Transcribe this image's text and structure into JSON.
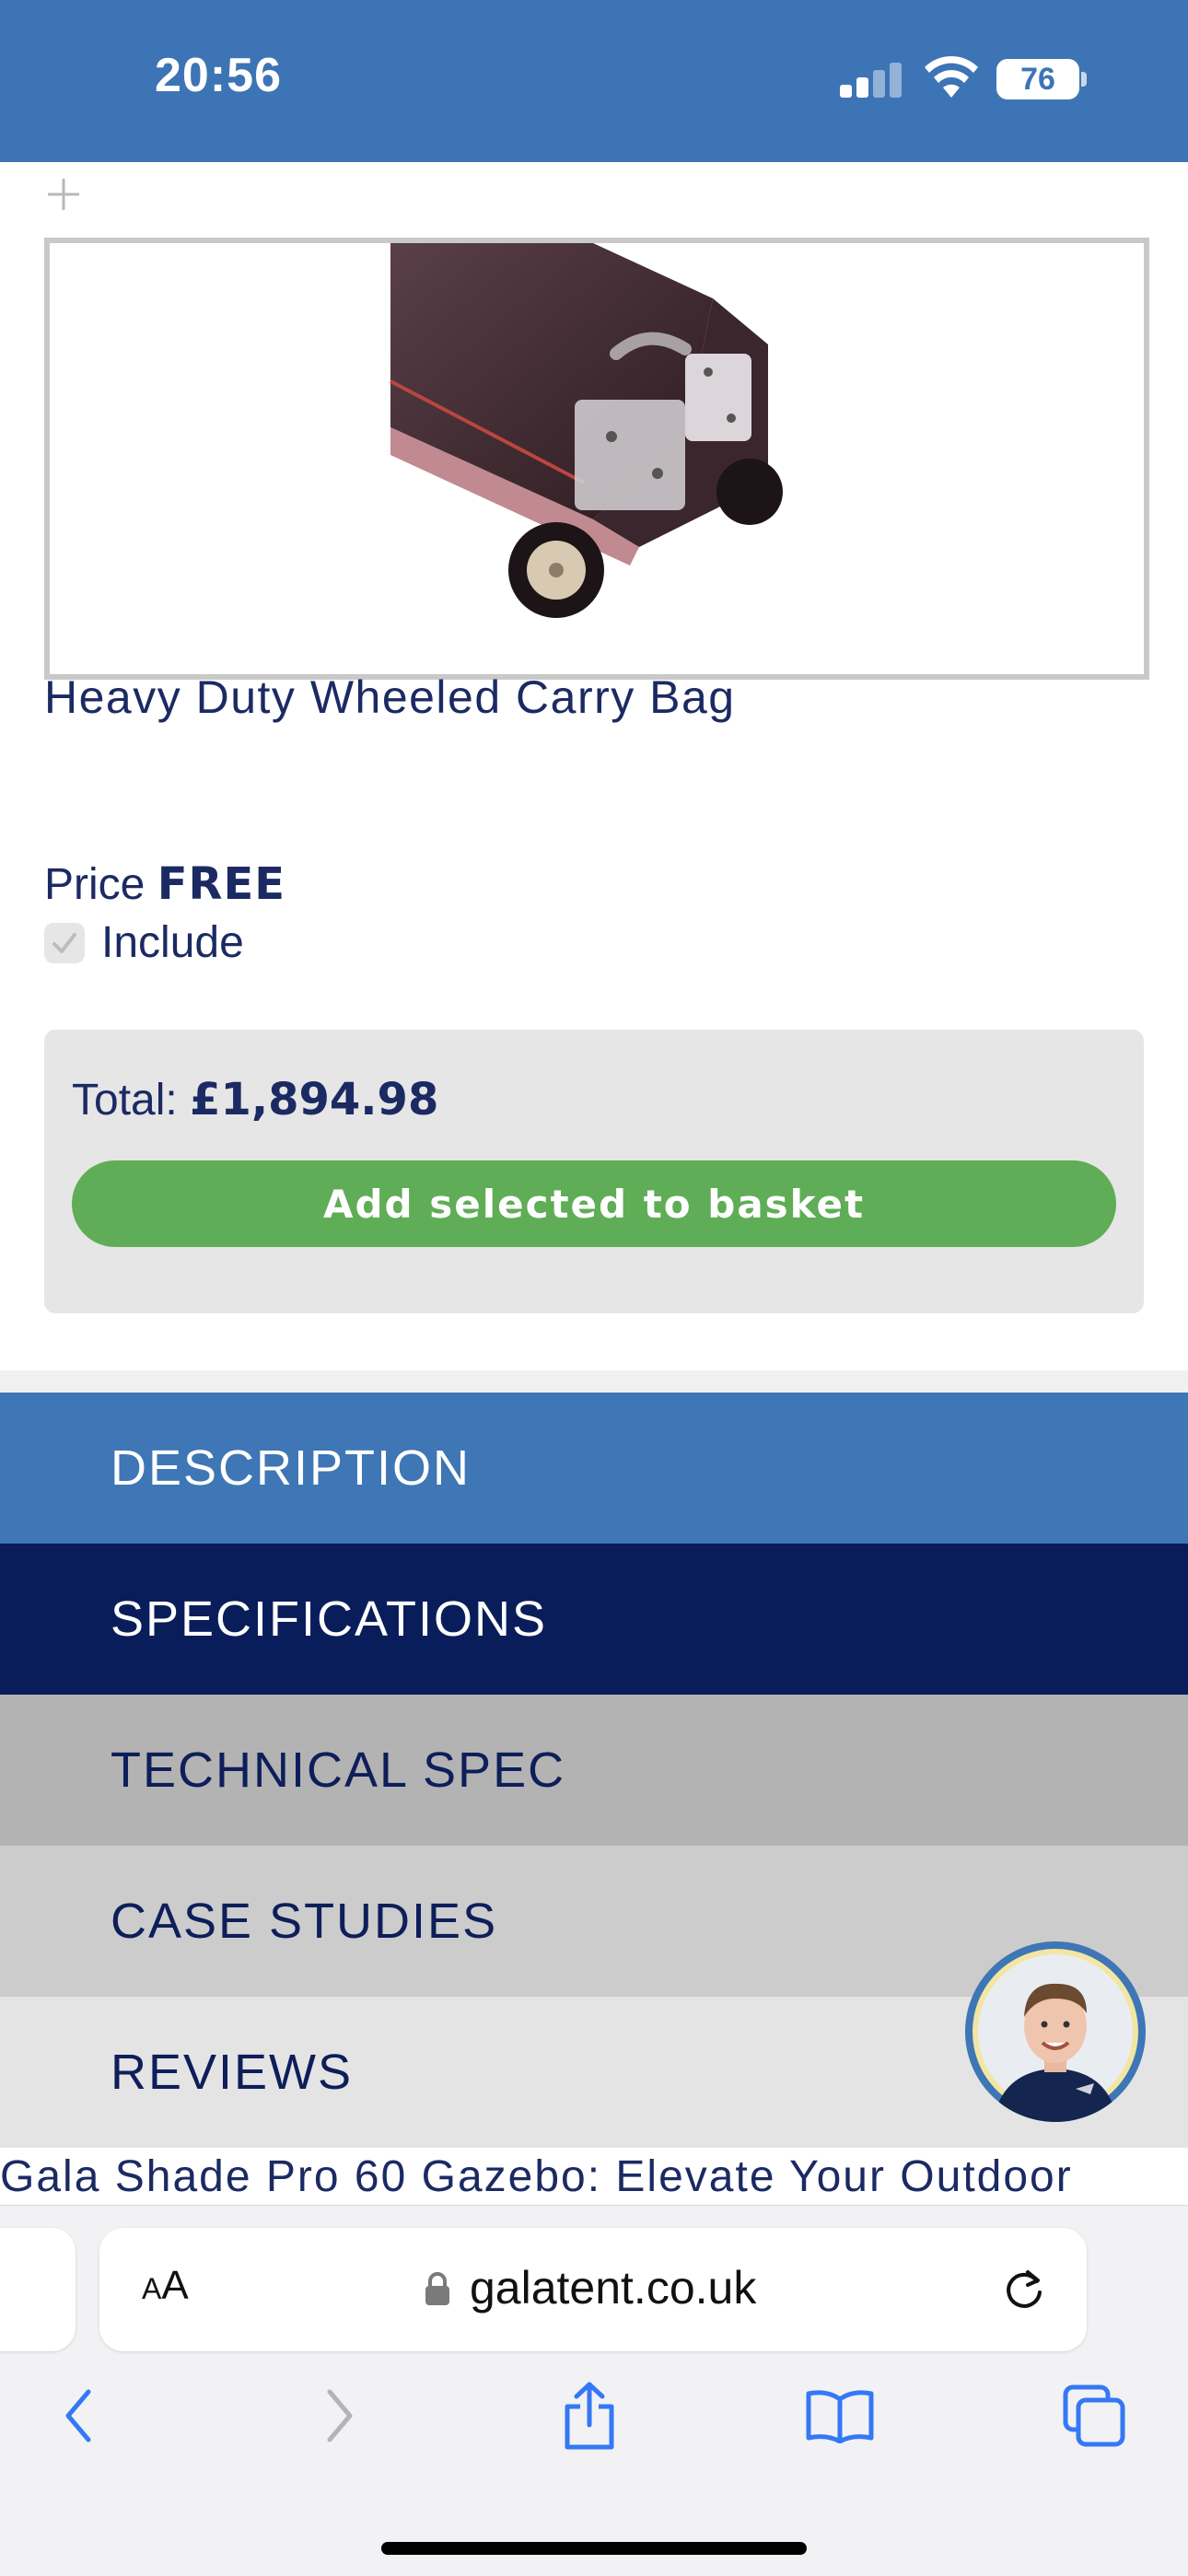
{
  "status_bar": {
    "time": "20:56",
    "battery": "76"
  },
  "product": {
    "title": "Heavy Duty Wheeled Carry Bag",
    "price_label": "Price",
    "price_value": "FREE",
    "include_label": "Include"
  },
  "basket": {
    "total_label": "Total:",
    "total_value": "£1,894.98",
    "add_button": "Add selected to basket"
  },
  "tabs": [
    {
      "label": "DESCRIPTION"
    },
    {
      "label": "SPECIFICATIONS"
    },
    {
      "label": "TECHNICAL SPEC"
    },
    {
      "label": "CASE STUDIES"
    },
    {
      "label": "REVIEWS"
    }
  ],
  "article": {
    "heading": "Gala Shade Pro 60 Gazebo: Elevate Your Outdoor"
  },
  "browser": {
    "aa_small": "A",
    "aa_large": "A",
    "url": "galatent.co.uk"
  },
  "colors": {
    "brand_blue": "#3d74b5",
    "navy": "#0a1d5b",
    "button_green": "#5fad56"
  },
  "icons": [
    "plus-icon",
    "checkmark-icon",
    "lock-icon",
    "reload-icon",
    "back-icon",
    "forward-icon",
    "share-icon",
    "bookmarks-icon",
    "tabs-icon"
  ]
}
